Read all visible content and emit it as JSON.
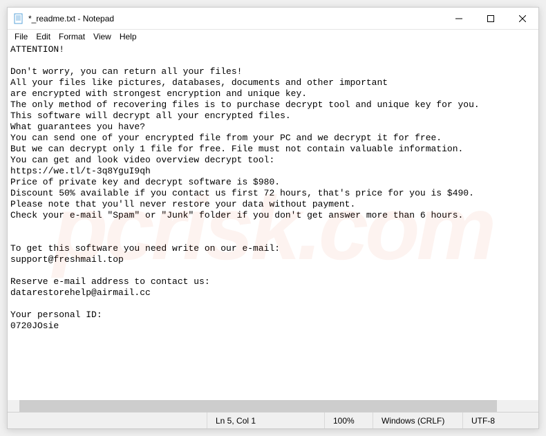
{
  "window": {
    "title": "*_readme.txt - Notepad"
  },
  "menubar": {
    "file": "File",
    "edit": "Edit",
    "format": "Format",
    "view": "View",
    "help": "Help"
  },
  "document": {
    "text": "ATTENTION!\n\nDon't worry, you can return all your files!\nAll your files like pictures, databases, documents and other important\nare encrypted with strongest encryption and unique key.\nThe only method of recovering files is to purchase decrypt tool and unique key for you.\nThis software will decrypt all your encrypted files.\nWhat guarantees you have?\nYou can send one of your encrypted file from your PC and we decrypt it for free.\nBut we can decrypt only 1 file for free. File must not contain valuable information.\nYou can get and look video overview decrypt tool:\nhttps://we.tl/t-3q8YguI9qh\nPrice of private key and decrypt software is $980.\nDiscount 50% available if you contact us first 72 hours, that's price for you is $490.\nPlease note that you'll never restore your data without payment.\nCheck your e-mail \"Spam\" or \"Junk\" folder if you don't get answer more than 6 hours.\n\n\nTo get this software you need write on our e-mail:\nsupport@freshmail.top\n\nReserve e-mail address to contact us:\ndatarestorehelp@airmail.cc\n\nYour personal ID:\n0720JOsie"
  },
  "statusbar": {
    "position": "Ln 5, Col 1",
    "zoom": "100%",
    "lineending": "Windows (CRLF)",
    "encoding": "UTF-8"
  },
  "watermark": "pcrisk.com"
}
